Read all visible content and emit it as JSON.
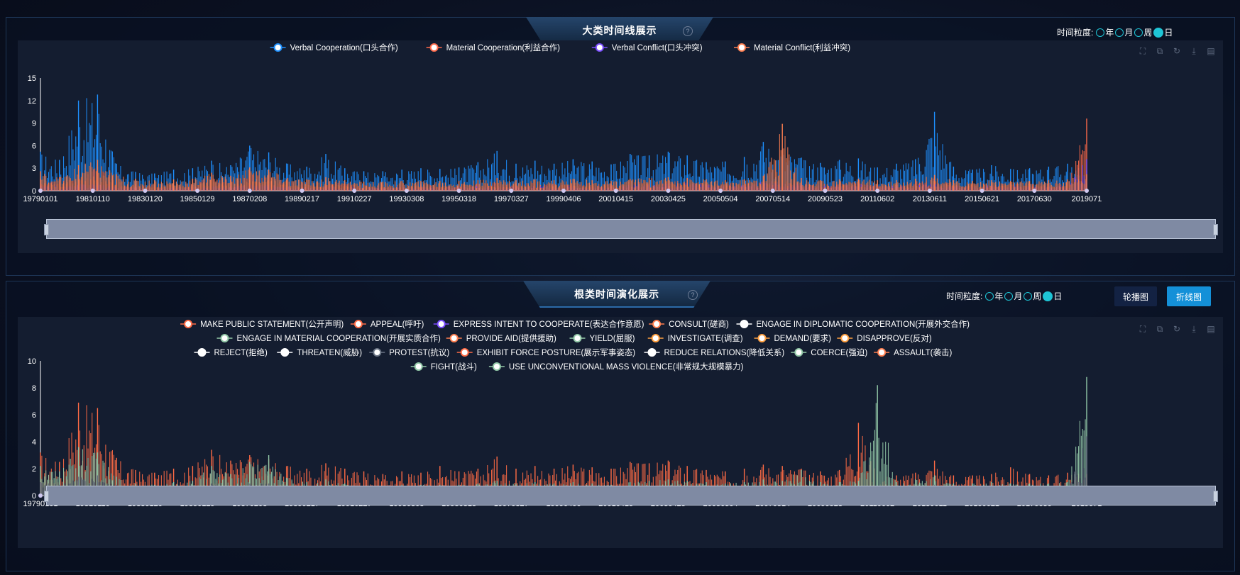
{
  "panels": [
    {
      "title": "大类时间线展示",
      "granularity": {
        "label": "时间粒度:",
        "options": [
          "年",
          "月",
          "周",
          "日"
        ],
        "selected": "日"
      },
      "help": "?",
      "toolbox": [
        "zoom-icon",
        "zoom-reset-icon",
        "restore-icon",
        "download-icon",
        "data-view-icon"
      ]
    },
    {
      "title": "根类时间演化展示",
      "granularity": {
        "label": "时间粒度:",
        "options": [
          "年",
          "月",
          "周",
          "日"
        ],
        "selected": "日"
      },
      "help": "?",
      "buttons": {
        "carousel": "轮播图",
        "line": "折线图"
      },
      "toolbox": [
        "zoom-icon",
        "zoom-reset-icon",
        "restore-icon",
        "download-icon",
        "data-view-icon"
      ]
    }
  ],
  "colors": {
    "verbal_coop": "#1e90ff",
    "material_coop": "#ff6a4a",
    "verbal_conflict": "#7b4dff",
    "material_conflict": "#ff7f50",
    "orange": "#ff6b45",
    "green": "#93c9a8",
    "gray": "#6b7585"
  },
  "chart_data": [
    {
      "type": "line",
      "title": "大类时间线展示",
      "x_ticks": [
        "19790101",
        "19810110",
        "19830120",
        "19850129",
        "19870208",
        "19890217",
        "19910227",
        "19930308",
        "19950318",
        "19970327",
        "19990406",
        "20010415",
        "20030425",
        "20050504",
        "20070514",
        "20090523",
        "20110602",
        "20130611",
        "20150621",
        "20170630",
        "2019071"
      ],
      "y_ticks": [
        0,
        3,
        6,
        9,
        12,
        15
      ],
      "ylim": [
        0,
        15
      ],
      "legend_position": "top-center",
      "series": [
        {
          "name": "Verbal Cooperation(口头合作)",
          "color": "#1e90ff",
          "values": [
            5.2,
            4.1,
            12.0,
            12.8,
            3.6,
            2.5,
            2.3,
            2.8,
            3.0,
            4.0,
            3.4,
            6.0,
            5.1,
            3.6,
            3.2,
            4.9,
            3.0,
            2.6,
            2.6,
            2.8,
            3.0,
            2.9,
            3.1,
            3.8,
            5.3,
            3.6,
            4.0,
            3.6,
            4.2,
            3.9,
            3.5,
            4.9,
            4.7,
            5.2,
            4.7,
            3.8,
            3.9,
            4.5,
            6.5,
            5.6,
            4.4,
            3.7,
            4.1,
            4.3,
            3.1,
            3.6,
            4.2,
            10.5,
            3.2,
            2.8,
            3.4,
            2.9,
            3.0,
            3.2,
            3.6,
            2.7
          ]
        },
        {
          "name": "Material Cooperation(利益合作)",
          "color": "#ff6a4a",
          "values": [
            1.6,
            1.2,
            2.1,
            3.2,
            1.3,
            0.9,
            0.8,
            1.0,
            1.1,
            1.9,
            1.5,
            2.6,
            2.2,
            1.4,
            1.1,
            1.4,
            1.0,
            0.8,
            0.8,
            0.9,
            0.9,
            0.9,
            0.9,
            1.0,
            1.2,
            1.0,
            1.1,
            1.0,
            1.1,
            1.0,
            0.9,
            1.2,
            1.3,
            1.4,
            1.3,
            1.1,
            1.0,
            1.1,
            1.3,
            1.4,
            1.2,
            1.0,
            1.1,
            1.2,
            1.0,
            1.0,
            1.3,
            1.8,
            1.0,
            1.0,
            1.1,
            1.0,
            1.0,
            1.0,
            1.1,
            9.6
          ]
        },
        {
          "name": "Verbal Conflict(口头冲突)",
          "color": "#7b4dff",
          "values": [
            0.7,
            0.6,
            0.9,
            1.1,
            0.6,
            0.5,
            0.4,
            0.5,
            0.5,
            0.7,
            0.6,
            0.9,
            0.8,
            0.6,
            0.5,
            0.6,
            0.5,
            0.4,
            0.4,
            0.5,
            0.5,
            0.5,
            0.5,
            0.6,
            0.7,
            0.6,
            0.7,
            0.6,
            0.7,
            0.6,
            0.6,
            0.8,
            0.9,
            1.0,
            1.1,
            0.8,
            0.7,
            0.8,
            1.4,
            1.2,
            0.9,
            0.7,
            0.8,
            0.9,
            0.7,
            0.7,
            0.8,
            1.0,
            0.7,
            0.6,
            0.7,
            0.7,
            0.6,
            0.7,
            0.7,
            4.2
          ]
        },
        {
          "name": "Material Conflict(利益冲突)",
          "color": "#ff7f50",
          "values": [
            2.6,
            1.8,
            3.4,
            4.1,
            2.2,
            1.6,
            1.4,
            1.5,
            1.6,
            2.4,
            2.0,
            3.1,
            2.8,
            1.7,
            1.5,
            1.8,
            1.4,
            1.2,
            1.2,
            1.3,
            1.3,
            1.3,
            1.3,
            1.4,
            1.7,
            1.4,
            1.5,
            1.4,
            1.6,
            1.4,
            1.3,
            1.6,
            1.7,
            1.8,
            1.7,
            1.5,
            1.4,
            1.5,
            2.0,
            8.9,
            1.7,
            1.4,
            1.5,
            1.6,
            1.4,
            1.4,
            1.6,
            2.1,
            1.4,
            1.3,
            1.4,
            1.3,
            1.3,
            1.4,
            1.5,
            2.2
          ]
        }
      ]
    },
    {
      "type": "line",
      "title": "根类时间演化展示",
      "x_ticks": [
        "19790101",
        "19810110",
        "19830120",
        "19850129",
        "19870208",
        "19890217",
        "19910227",
        "19930308",
        "19950318",
        "19970327",
        "19990406",
        "20010415",
        "20030425",
        "20050504",
        "20070514",
        "20090523",
        "20110602",
        "20130611",
        "20150621",
        "20170630",
        "2019071"
      ],
      "y_ticks": [
        0,
        2,
        4,
        6,
        8,
        10
      ],
      "ylim": [
        0,
        10
      ],
      "legend_position": "top-center",
      "legend": [
        "MAKE PUBLIC STATEMENT(公开声明)",
        "APPEAL(呼吁)",
        "EXPRESS INTENT TO COOPERATE(表达合作意愿)",
        "CONSULT(磋商)",
        "ENGAGE IN DIPLOMATIC COOPERATION(开展外交合作)",
        "ENGAGE IN MATERIAL COOPERATION(开展实质合作)",
        "PROVIDE AID(提供援助)",
        "YIELD(屈服)",
        "INVESTIGATE(调查)",
        "DEMAND(要求)",
        "DISAPPROVE(反对)",
        "REJECT(拒绝)",
        "THREATEN(威胁)",
        "PROTEST(抗议)",
        "EXHIBIT FORCE POSTURE(展示军事姿态)",
        "REDUCE RELATIONS(降低关系)",
        "COERCE(强迫)",
        "ASSAULT(袭击)",
        "FIGHT(战斗)",
        "USE UNCONVENTIONAL MASS VIOLENCE(非常规大规模暴力)"
      ],
      "legend_colors": [
        "#ff6b45",
        "#ff6b45",
        "#7b4dff",
        "#ff7f50",
        "#ffffff",
        "#93c9a8",
        "#ff7f50",
        "#93c9a8",
        "#ffa040",
        "#ffa040",
        "#ffa040",
        "#ffffff",
        "#ffffff",
        "#6b7585",
        "#ff6b45",
        "#ffffff",
        "#93c9a8",
        "#ff7f50",
        "#93c9a8",
        "#93c9a8"
      ],
      "series": [
        {
          "name": "ASSAULT(袭击)",
          "color": "#ff6b45",
          "values": [
            3.2,
            2.5,
            6.9,
            6.5,
            2.8,
            1.9,
            1.7,
            2.0,
            2.2,
            3.4,
            2.6,
            3.0,
            2.7,
            2.2,
            2.0,
            2.4,
            2.0,
            1.8,
            1.6,
            1.8,
            1.7,
            2.2,
            1.8,
            2.0,
            2.9,
            2.0,
            2.2,
            2.0,
            2.3,
            2.1,
            2.0,
            2.5,
            2.4,
            2.6,
            2.2,
            1.9,
            1.8,
            2.0,
            2.3,
            2.2,
            2.0,
            1.8,
            1.9,
            5.4,
            1.6,
            1.5,
            1.7,
            2.6,
            1.5,
            1.5,
            1.6,
            2.1,
            1.6,
            1.5,
            1.7,
            1.6
          ]
        },
        {
          "name": "FIGHT(战斗)",
          "color": "#93c9a8",
          "values": [
            2.2,
            1.8,
            3.6,
            3.2,
            1.4,
            0.9,
            0.8,
            1.0,
            1.1,
            2.2,
            1.6,
            2.5,
            3.0,
            1.3,
            1.0,
            1.2,
            0.9,
            0.7,
            0.7,
            0.8,
            0.8,
            0.8,
            0.8,
            0.9,
            1.1,
            0.9,
            1.0,
            0.9,
            1.0,
            0.9,
            0.8,
            1.0,
            1.1,
            1.2,
            1.1,
            1.0,
            0.9,
            1.0,
            1.2,
            1.1,
            1.9,
            1.0,
            1.0,
            1.1,
            8.2,
            1.0,
            1.2,
            1.5,
            0.9,
            0.9,
            1.0,
            0.9,
            0.9,
            0.9,
            1.0,
            8.8
          ]
        },
        {
          "name": "PROTEST(抗议)",
          "color": "#6b7585",
          "values": [
            1.0,
            0.8,
            1.4,
            1.5,
            0.8,
            0.6,
            0.5,
            0.6,
            0.6,
            0.9,
            0.7,
            0.9,
            0.9,
            0.6,
            0.5,
            0.6,
            0.5,
            0.5,
            0.5,
            0.5,
            0.5,
            0.5,
            0.5,
            0.6,
            0.7,
            0.6,
            0.6,
            0.6,
            0.6,
            0.6,
            0.5,
            0.6,
            0.7,
            0.7,
            0.7,
            0.6,
            0.6,
            0.6,
            0.7,
            0.7,
            0.6,
            0.6,
            0.6,
            0.7,
            0.6,
            0.6,
            0.7,
            0.8,
            0.6,
            0.6,
            0.6,
            0.6,
            0.6,
            0.6,
            0.6,
            4.4
          ]
        }
      ]
    }
  ]
}
